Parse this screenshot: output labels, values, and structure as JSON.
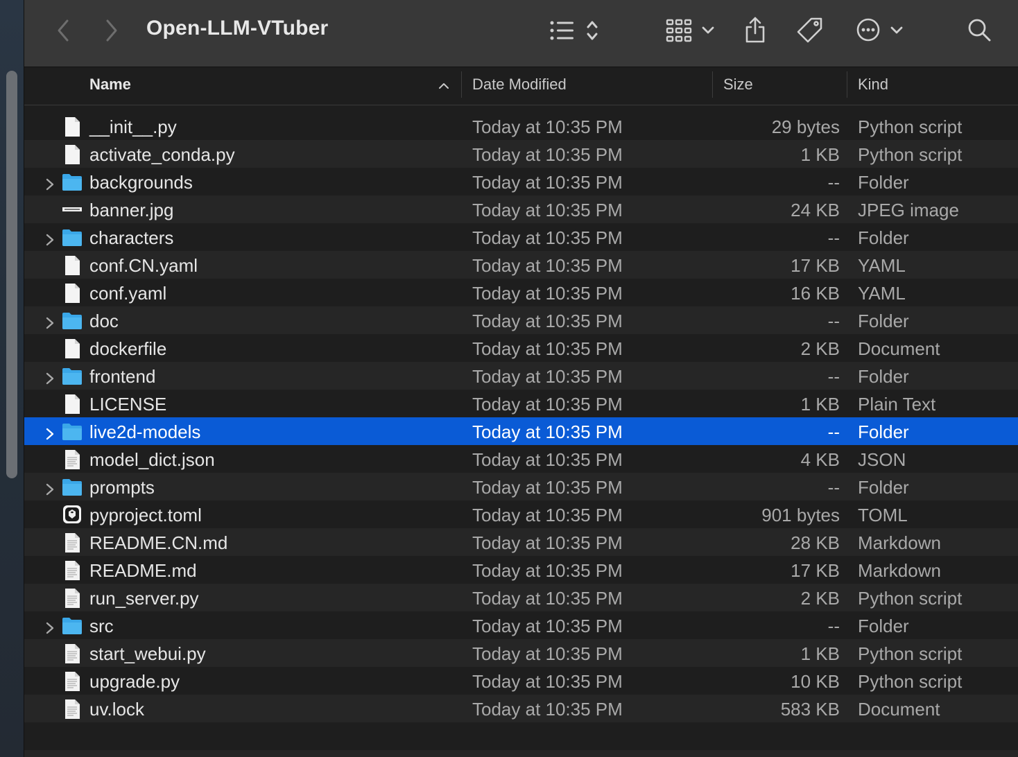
{
  "window": {
    "title": "Open-LLM-VTuber"
  },
  "toolbar": {
    "icons": [
      "back-icon",
      "forward-icon",
      "list-view-icon",
      "sort-updown-icon",
      "icon-view-grid-icon",
      "chevron-down-icon",
      "share-icon",
      "tag-icon",
      "more-ellipsis-icon",
      "search-icon"
    ]
  },
  "columns": {
    "name": "Name",
    "date": "Date Modified",
    "size": "Size",
    "kind": "Kind"
  },
  "colors": {
    "selection": "#0a5bd6",
    "folder": "#3aa7e8"
  },
  "files": [
    {
      "name": "__init__.py",
      "date": "Today at 10:35 PM",
      "size": "29 bytes",
      "kind": "Python script",
      "type": "file",
      "icon": "doc-blank-icon"
    },
    {
      "name": "activate_conda.py",
      "date": "Today at 10:35 PM",
      "size": "1 KB",
      "kind": "Python script",
      "type": "file",
      "icon": "doc-blank-icon"
    },
    {
      "name": "backgrounds",
      "date": "Today at 10:35 PM",
      "size": "--",
      "kind": "Folder",
      "type": "folder",
      "icon": "folder-icon"
    },
    {
      "name": "banner.jpg",
      "date": "Today at 10:35 PM",
      "size": "24 KB",
      "kind": "JPEG image",
      "type": "file",
      "icon": "image-thumb-icon"
    },
    {
      "name": "characters",
      "date": "Today at 10:35 PM",
      "size": "--",
      "kind": "Folder",
      "type": "folder",
      "icon": "folder-icon"
    },
    {
      "name": "conf.CN.yaml",
      "date": "Today at 10:35 PM",
      "size": "17 KB",
      "kind": "YAML",
      "type": "file",
      "icon": "doc-blank-icon"
    },
    {
      "name": "conf.yaml",
      "date": "Today at 10:35 PM",
      "size": "16 KB",
      "kind": "YAML",
      "type": "file",
      "icon": "doc-blank-icon"
    },
    {
      "name": "doc",
      "date": "Today at 10:35 PM",
      "size": "--",
      "kind": "Folder",
      "type": "folder",
      "icon": "folder-icon"
    },
    {
      "name": "dockerfile",
      "date": "Today at 10:35 PM",
      "size": "2 KB",
      "kind": "Document",
      "type": "file",
      "icon": "doc-blank-icon"
    },
    {
      "name": "frontend",
      "date": "Today at 10:35 PM",
      "size": "--",
      "kind": "Folder",
      "type": "folder",
      "icon": "folder-icon"
    },
    {
      "name": "LICENSE",
      "date": "Today at 10:35 PM",
      "size": "1 KB",
      "kind": "Plain Text",
      "type": "file",
      "icon": "doc-blank-icon"
    },
    {
      "name": "live2d-models",
      "date": "Today at 10:35 PM",
      "size": "--",
      "kind": "Folder",
      "type": "folder",
      "icon": "folder-icon",
      "selected": true
    },
    {
      "name": "model_dict.json",
      "date": "Today at 10:35 PM",
      "size": "4 KB",
      "kind": "JSON",
      "type": "file",
      "icon": "doc-text-icon"
    },
    {
      "name": "prompts",
      "date": "Today at 10:35 PM",
      "size": "--",
      "kind": "Folder",
      "type": "folder",
      "icon": "folder-icon"
    },
    {
      "name": "pyproject.toml",
      "date": "Today at 10:35 PM",
      "size": "901 bytes",
      "kind": "TOML",
      "type": "file",
      "icon": "toml-app-icon"
    },
    {
      "name": "README.CN.md",
      "date": "Today at 10:35 PM",
      "size": "28 KB",
      "kind": "Markdown",
      "type": "file",
      "icon": "doc-text-icon"
    },
    {
      "name": "README.md",
      "date": "Today at 10:35 PM",
      "size": "17 KB",
      "kind": "Markdown",
      "type": "file",
      "icon": "doc-text-icon"
    },
    {
      "name": "run_server.py",
      "date": "Today at 10:35 PM",
      "size": "2 KB",
      "kind": "Python script",
      "type": "file",
      "icon": "doc-text-icon"
    },
    {
      "name": "src",
      "date": "Today at 10:35 PM",
      "size": "--",
      "kind": "Folder",
      "type": "folder",
      "icon": "folder-icon"
    },
    {
      "name": "start_webui.py",
      "date": "Today at 10:35 PM",
      "size": "1 KB",
      "kind": "Python script",
      "type": "file",
      "icon": "doc-text-icon"
    },
    {
      "name": "upgrade.py",
      "date": "Today at 10:35 PM",
      "size": "10 KB",
      "kind": "Python script",
      "type": "file",
      "icon": "doc-text-icon"
    },
    {
      "name": "uv.lock",
      "date": "Today at 10:35 PM",
      "size": "583 KB",
      "kind": "Document",
      "type": "file",
      "icon": "doc-lines-icon"
    }
  ]
}
